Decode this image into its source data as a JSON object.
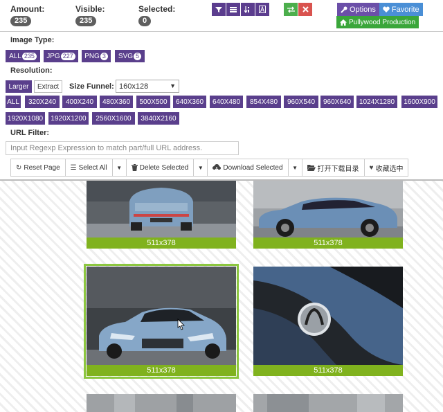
{
  "stats": {
    "amount_label": "Amount:",
    "amount_value": "235",
    "visible_label": "Visible:",
    "visible_value": "235",
    "selected_label": "Selected:",
    "selected_value": "0"
  },
  "toolbar": {
    "filter_icon": "filter-icon",
    "list_icon": "list-icon",
    "sort_icon": "sort-icon",
    "text_icon": "font-icon",
    "swap_icon": "swap-icon",
    "close_icon": "close-icon",
    "options_label": "Options",
    "favorite_label": "Favorite",
    "production_label": "Pullywood Production"
  },
  "filters": {
    "image_type_label": "Image Type:",
    "types": [
      {
        "label": "ALL",
        "count": "235"
      },
      {
        "label": "JPG",
        "count": "227"
      },
      {
        "label": "PNG",
        "count": "3"
      },
      {
        "label": "SVG",
        "count": "5"
      }
    ],
    "resolution_label": "Resolution:",
    "larger_label": "Larger",
    "extract_label": "Extract",
    "size_funnel_label": "Size Funnel:",
    "size_funnel_value": "160x128",
    "resolutions": [
      "ALL",
      "320X240",
      "400X240",
      "480X360",
      "500X500",
      "640X360",
      "640X480",
      "854X480",
      "960X540",
      "960X640",
      "1024X1280",
      "1600X900",
      "1920X1080",
      "1920X1200",
      "2560X1600",
      "3840X2160"
    ],
    "url_filter_label": "URL Filter:",
    "url_placeholder": "Input Regexp Expression to match part/full URL address."
  },
  "actions": {
    "reset_label": "Reset Page",
    "select_all_label": "Select All",
    "delete_label": "Delete Selected",
    "download_label": "Download Selected",
    "open_dir_label": "打开下载目录",
    "favorite_selected_label": "收藏选中"
  },
  "gallery": {
    "images": [
      {
        "caption": "511x378",
        "subject": "car-rear-view"
      },
      {
        "caption": "511x378",
        "subject": "car-side-view"
      },
      {
        "caption": "511x378",
        "subject": "car-front-view"
      },
      {
        "caption": "511x378",
        "subject": "car-badge-closeup"
      },
      {
        "caption": "",
        "subject": "partial-image"
      },
      {
        "caption": "",
        "subject": "partial-image"
      }
    ]
  },
  "colors": {
    "purple": "#5a3f8c",
    "green": "#80b21e",
    "selected_outline": "#8cc63f"
  }
}
